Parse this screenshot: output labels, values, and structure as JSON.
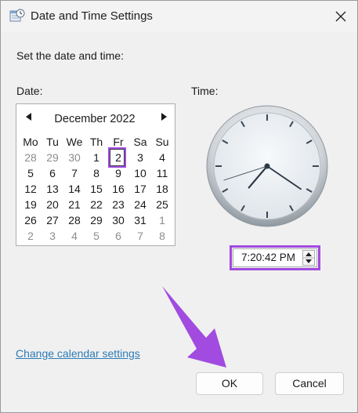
{
  "window": {
    "title": "Date and Time Settings",
    "icon": "calendar-clock-icon",
    "close_icon": "close-icon"
  },
  "prompt": "Set the date and time:",
  "date_label": "Date:",
  "time_label": "Time:",
  "calendar": {
    "month_label": "December 2022",
    "prev_icon": "triangle-left-icon",
    "next_icon": "triangle-right-icon",
    "weekdays": [
      "Mo",
      "Tu",
      "We",
      "Th",
      "Fr",
      "Sa",
      "Su"
    ],
    "weeks": [
      [
        "28",
        "29",
        "30",
        "1",
        "2",
        "3",
        "4"
      ],
      [
        "5",
        "6",
        "7",
        "8",
        "9",
        "10",
        "11"
      ],
      [
        "12",
        "13",
        "14",
        "15",
        "16",
        "17",
        "18"
      ],
      [
        "19",
        "20",
        "21",
        "22",
        "23",
        "24",
        "25"
      ],
      [
        "26",
        "27",
        "28",
        "29",
        "30",
        "31",
        "1"
      ],
      [
        "2",
        "3",
        "4",
        "5",
        "6",
        "7",
        "8"
      ]
    ],
    "selected_day": "2"
  },
  "clock": {
    "hours": 7,
    "minutes": 20,
    "seconds": 42
  },
  "time_value": "7:20:42 PM",
  "link": "Change calendar settings",
  "buttons": {
    "ok": "OK",
    "cancel": "Cancel"
  },
  "colors": {
    "highlight": "#a14be0",
    "link": "#2d7bb5"
  }
}
